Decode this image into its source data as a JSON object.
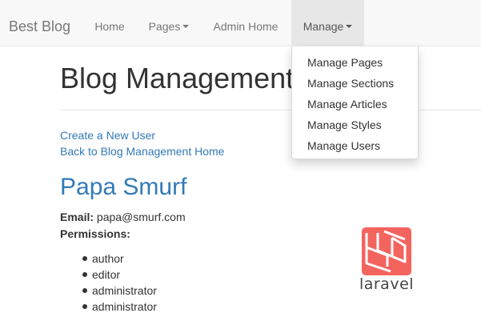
{
  "navbar": {
    "brand": "Best Blog",
    "items": [
      {
        "label": "Home",
        "dropdown": false
      },
      {
        "label": "Pages",
        "dropdown": true
      },
      {
        "label": "Admin Home",
        "dropdown": false
      },
      {
        "label": "Manage",
        "dropdown": true,
        "active": true
      }
    ]
  },
  "dropdown": {
    "items": [
      {
        "label": "Manage Pages"
      },
      {
        "label": "Manage Sections"
      },
      {
        "label": "Manage Articles"
      },
      {
        "label": "Manage Styles"
      },
      {
        "label": "Manage Users"
      }
    ]
  },
  "page": {
    "title": "Blog Management",
    "links": {
      "create_user": "Create a New User",
      "back_home": "Back to Blog Management Home"
    },
    "user": {
      "name": "Papa Smurf",
      "email_label": "Email:",
      "email": "papa@smurf.com",
      "permissions_label": "Permissions:",
      "permissions": [
        "author",
        "editor",
        "administrator",
        "administrator"
      ]
    }
  },
  "logo": {
    "name": "laravel-icon",
    "text": "laravel",
    "color": "#f4645f"
  },
  "colors": {
    "link": "#337ab7",
    "navbar_bg": "#f8f8f8",
    "nav_active_bg": "#e7e7e7",
    "nav_text": "#777777"
  }
}
